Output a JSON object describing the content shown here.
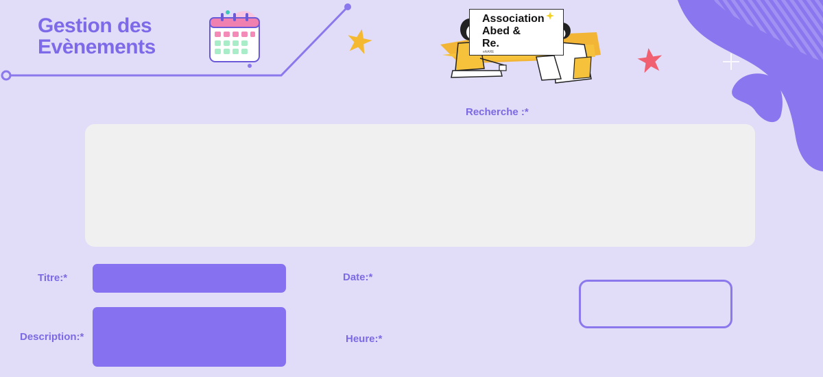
{
  "header": {
    "title_line1": "Gestion des",
    "title_line2": "Evènements"
  },
  "logo": {
    "line1": "Association",
    "line2": "Abed &",
    "line3": "Re.",
    "small": "eAARE"
  },
  "search": {
    "label": "Recherche :*"
  },
  "form": {
    "titre_label": "Titre:*",
    "description_label": "Description:*",
    "date_label": "Date:*",
    "heure_label": "Heure:*"
  },
  "colors": {
    "background": "#e1dcf8",
    "accent": "#8672f0",
    "label": "#7b6ae4",
    "panel": "#f0f0f0",
    "star_yellow": "#f4b931",
    "star_red": "#f06070"
  }
}
